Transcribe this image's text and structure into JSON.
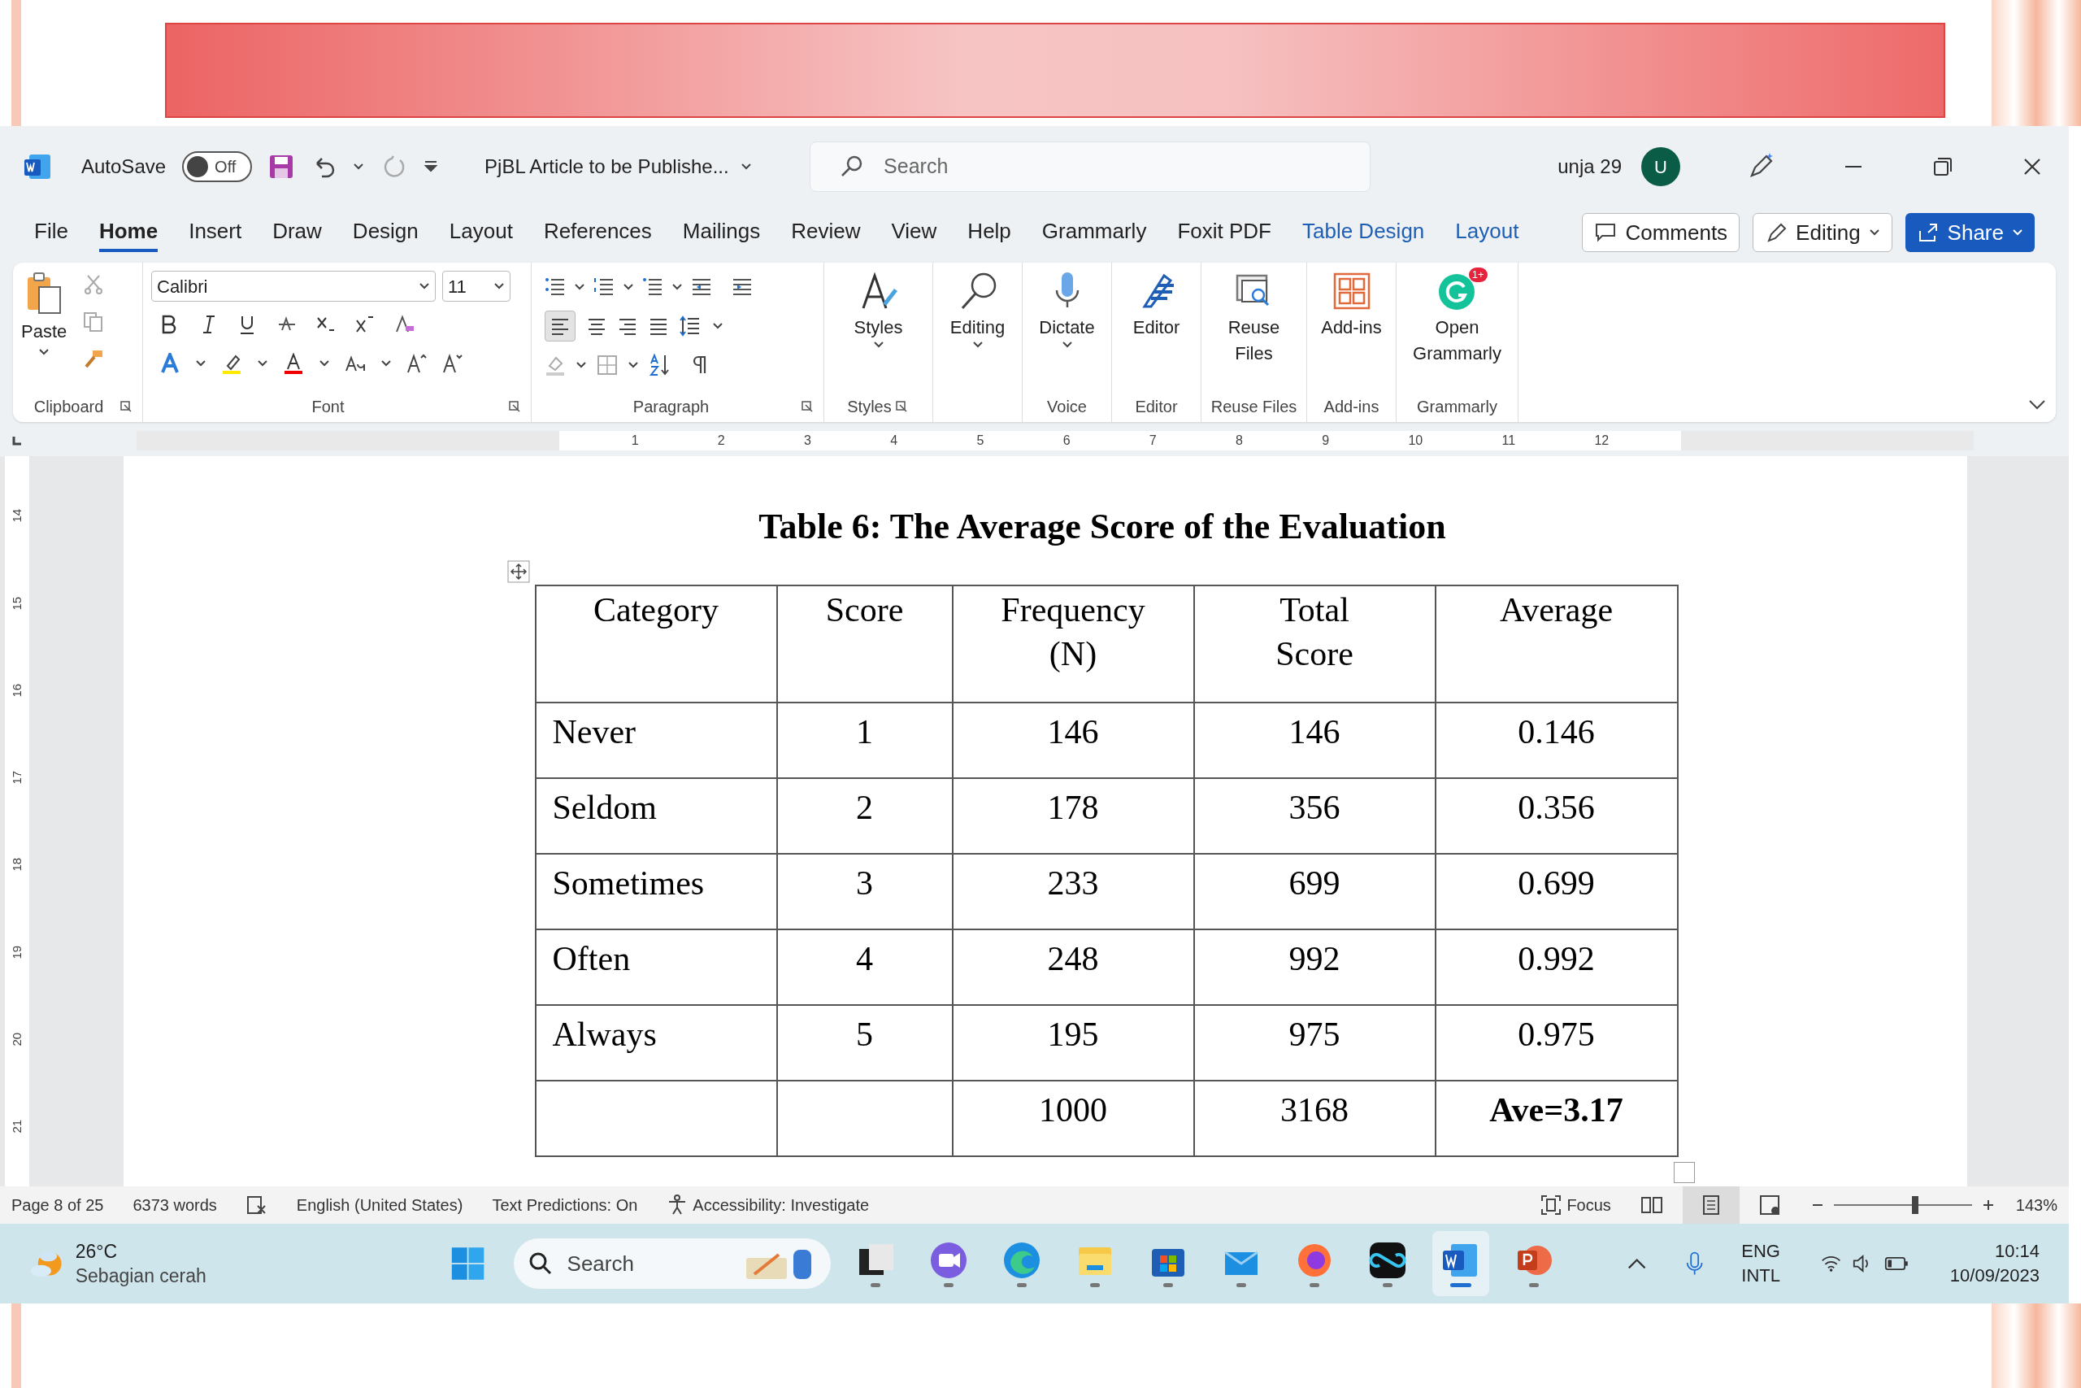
{
  "title_bar": {
    "autosave_label": "AutoSave",
    "autosave_toggle": {
      "label": "Off",
      "on": false
    },
    "document_title": "PjBL Article to be Publishe...",
    "search_placeholder": "Search",
    "user_name": "unja 29",
    "avatar_initial": "U"
  },
  "menu_tabs": [
    {
      "label": "File",
      "selected": false,
      "kind": "normal"
    },
    {
      "label": "Home",
      "selected": true,
      "kind": "normal"
    },
    {
      "label": "Insert",
      "selected": false,
      "kind": "normal"
    },
    {
      "label": "Draw",
      "selected": false,
      "kind": "normal"
    },
    {
      "label": "Design",
      "selected": false,
      "kind": "normal"
    },
    {
      "label": "Layout",
      "selected": false,
      "kind": "normal"
    },
    {
      "label": "References",
      "selected": false,
      "kind": "normal"
    },
    {
      "label": "Mailings",
      "selected": false,
      "kind": "normal"
    },
    {
      "label": "Review",
      "selected": false,
      "kind": "normal"
    },
    {
      "label": "View",
      "selected": false,
      "kind": "normal"
    },
    {
      "label": "Help",
      "selected": false,
      "kind": "normal"
    },
    {
      "label": "Grammarly",
      "selected": false,
      "kind": "normal"
    },
    {
      "label": "Foxit PDF",
      "selected": false,
      "kind": "normal"
    },
    {
      "label": "Table Design",
      "selected": false,
      "kind": "contextual"
    },
    {
      "label": "Layout",
      "selected": false,
      "kind": "contextual"
    }
  ],
  "header_buttons": [
    {
      "label": "Comments",
      "kind": "comments"
    },
    {
      "label": "Editing",
      "kind": "editing"
    },
    {
      "label": "Share",
      "kind": "share"
    }
  ],
  "ribbon": {
    "paste_label": "Paste",
    "font_name": "Calibri",
    "font_size": "11",
    "big_buttons": [
      {
        "label": "Styles",
        "kind": "styles",
        "group": "Styles"
      },
      {
        "label": "Editing",
        "kind": "editing"
      },
      {
        "label": "Dictate",
        "kind": "dictate",
        "group": "Voice"
      },
      {
        "label": "Editor",
        "kind": "editor",
        "group": "Editor"
      },
      {
        "label": "Reuse Files",
        "kind": "reuse",
        "group": "Reuse Files"
      },
      {
        "label": "Add-ins",
        "kind": "addins",
        "group": "Add-ins"
      },
      {
        "label": "Open Grammarly",
        "kind": "grammarly",
        "group": "Grammarly",
        "badge": "1+"
      }
    ],
    "group_labels": [
      "Clipboard",
      "Font",
      "Paragraph"
    ]
  },
  "ruler": {
    "horizontal": [
      "1",
      "2",
      "3",
      "4",
      "5",
      "6",
      "7",
      "8",
      "9",
      "10",
      "11",
      "12"
    ],
    "vertical": [
      "14",
      "15",
      "16",
      "17",
      "18",
      "19",
      "20",
      "21"
    ]
  },
  "document": {
    "table_title": "Table 6: The Average Score of the Evaluation",
    "columns": [
      "Category",
      "Score",
      "Frequency\n(N)",
      "Total\nScore",
      "Average"
    ],
    "rows": [
      {
        "kind": "data",
        "cells": [
          "Never",
          "1",
          "146",
          "146",
          "0.146"
        ]
      },
      {
        "kind": "data",
        "cells": [
          "Seldom",
          "2",
          "178",
          "356",
          "0.356"
        ]
      },
      {
        "kind": "data",
        "cells": [
          "Sometimes",
          "3",
          "233",
          "699",
          "0.699"
        ]
      },
      {
        "kind": "data",
        "cells": [
          "Often",
          "4",
          "248",
          "992",
          "0.992"
        ]
      },
      {
        "kind": "data",
        "cells": [
          "Always",
          "5",
          "195",
          "975",
          "0.975"
        ]
      },
      {
        "kind": "total",
        "cells": [
          "",
          "",
          "1000",
          "3168",
          "Ave=3.17"
        ]
      }
    ]
  },
  "status_bar": {
    "left": [
      "Page 8 of 25",
      "6373 words",
      "English (United States)",
      "Text Predictions: On",
      "Accessibility: Investigate"
    ],
    "focus": "Focus",
    "zoom": {
      "level": 0.59,
      "reading": "143%"
    }
  },
  "taskbar": {
    "temperature": "26°C",
    "weather": "Sebagian cerah",
    "search_placeholder": "Search",
    "apps": [
      {
        "kind": "files",
        "active": false
      },
      {
        "kind": "meet",
        "active": false
      },
      {
        "kind": "edge",
        "active": false
      },
      {
        "kind": "folder",
        "active": false
      },
      {
        "kind": "store",
        "active": false
      },
      {
        "kind": "mail",
        "active": false
      },
      {
        "kind": "firefox",
        "active": false
      },
      {
        "kind": "capcut",
        "active": false
      },
      {
        "kind": "word",
        "active": true
      },
      {
        "kind": "powerpoint",
        "active": false
      }
    ],
    "language": "ENG",
    "layout": "INTL",
    "time": "10:14",
    "date": "10/09/2023"
  }
}
